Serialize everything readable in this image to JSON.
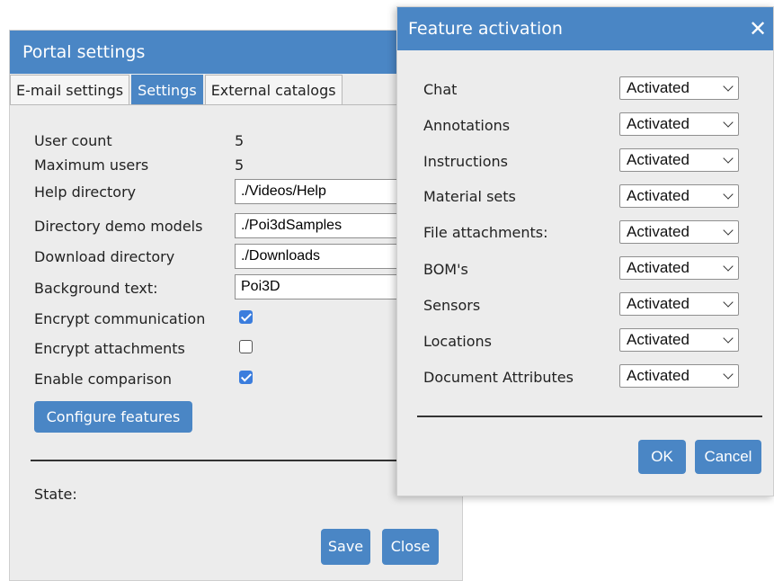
{
  "portal": {
    "title": "Portal settings",
    "tabs": [
      {
        "label": "E-mail settings"
      },
      {
        "label": "Settings"
      },
      {
        "label": "External catalogs"
      }
    ],
    "fields": {
      "user_count_label": "User count",
      "user_count_value": "5",
      "max_users_label": "Maximum users",
      "max_users_value": "5",
      "help_dir_label": "Help directory",
      "help_dir_value": "./Videos/Help",
      "demo_dir_label": "Directory demo models",
      "demo_dir_value": "./Poi3dSamples",
      "download_dir_label": "Download directory",
      "download_dir_value": "./Downloads",
      "bg_text_label": "Background text:",
      "bg_text_value": "Poi3D",
      "encrypt_comm_label": "Encrypt communication",
      "encrypt_comm_checked": true,
      "encrypt_attach_label": "Encrypt attachments",
      "encrypt_attach_checked": false,
      "enable_comp_label": "Enable comparison",
      "enable_comp_checked": true
    },
    "configure_label": "Configure features",
    "state_label": "State:",
    "save_label": "Save",
    "close_label": "Close"
  },
  "feature": {
    "title": "Feature activation",
    "close_glyph": "✕",
    "items": [
      {
        "label": "Chat",
        "value": "Activated"
      },
      {
        "label": "Annotations",
        "value": "Activated"
      },
      {
        "label": "Instructions",
        "value": "Activated"
      },
      {
        "label": "Material sets",
        "value": "Activated"
      },
      {
        "label": "File attachments:",
        "value": "Activated"
      },
      {
        "label": "BOM's",
        "value": "Activated"
      },
      {
        "label": "Sensors",
        "value": "Activated"
      },
      {
        "label": "Locations",
        "value": "Activated"
      },
      {
        "label": "Document Attributes",
        "value": "Activated"
      }
    ],
    "ok_label": "OK",
    "cancel_label": "Cancel"
  },
  "colors": {
    "accent": "#4a86c5",
    "checkbox": "#3b7ddd",
    "dialog_bg": "#ececec"
  }
}
